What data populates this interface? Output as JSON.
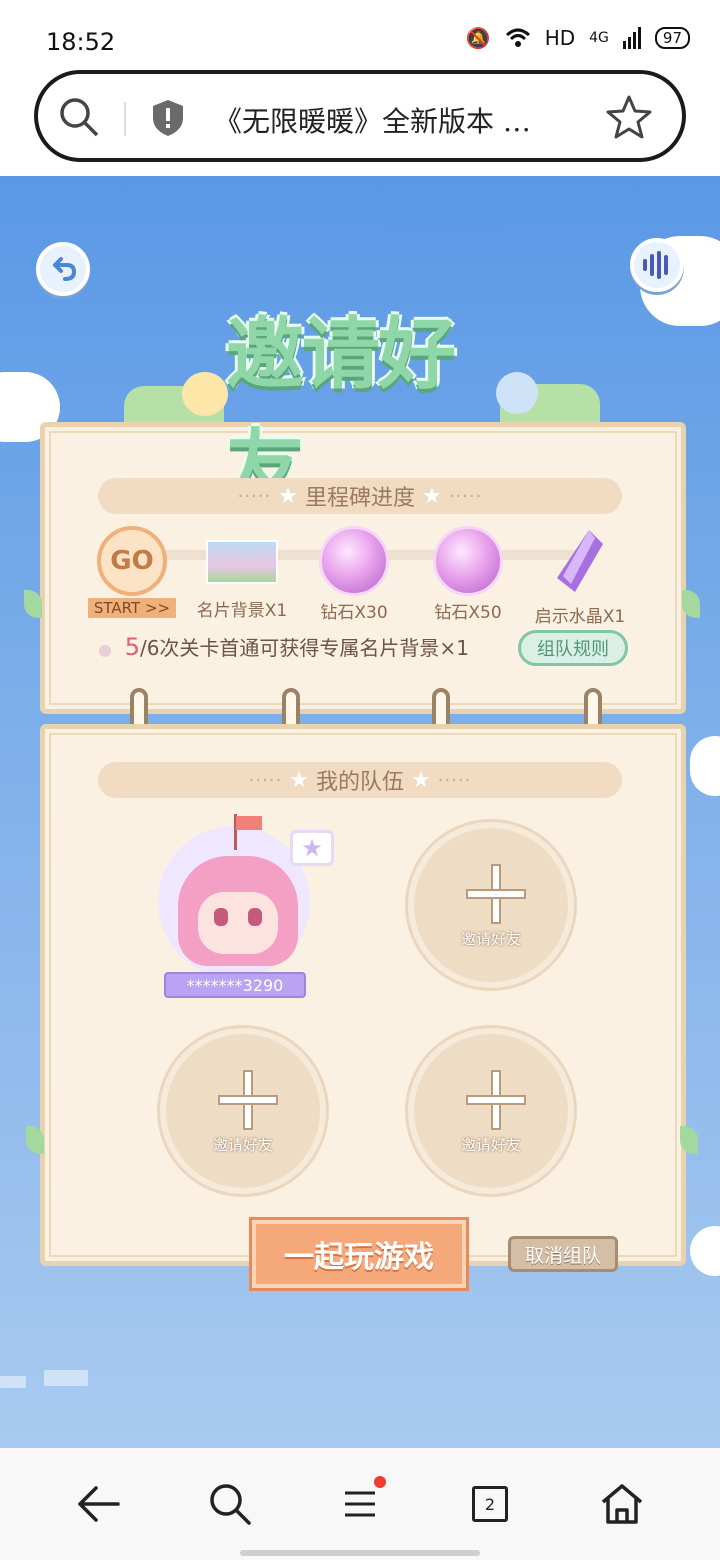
{
  "status_bar": {
    "time": "18:52",
    "network": "HD",
    "signal": "4G",
    "battery": "97"
  },
  "address_bar": {
    "title": "《无限暖暖》全新版本 …"
  },
  "game": {
    "title": "邀请好友",
    "milestone_header": "里程碑进度",
    "milestones": [
      {
        "label": "START >>",
        "icon": "go-badge"
      },
      {
        "label": "名片背景X1",
        "icon": "card-background"
      },
      {
        "label": "钻石X30",
        "icon": "diamond"
      },
      {
        "label": "钻石X50",
        "icon": "diamond"
      },
      {
        "label": "启示水晶X1",
        "icon": "crystal"
      }
    ],
    "go_text": "GO",
    "progress": {
      "count": "5",
      "text": "/6次关卡首通可获得专属名片背景×1"
    },
    "rules_button": "组队规则",
    "team_header": "我的队伍",
    "member_name": "*******3290",
    "invite_label": "邀请好友",
    "play_button": "一起玩游戏",
    "cancel_button": "取消组队"
  },
  "nav": {
    "tabs_count": "2"
  },
  "colors": {
    "sky": "#5a98e6",
    "panel": "#fbf1e3",
    "accent_orange": "#f5a87a",
    "accent_green": "#7fc7a7"
  }
}
